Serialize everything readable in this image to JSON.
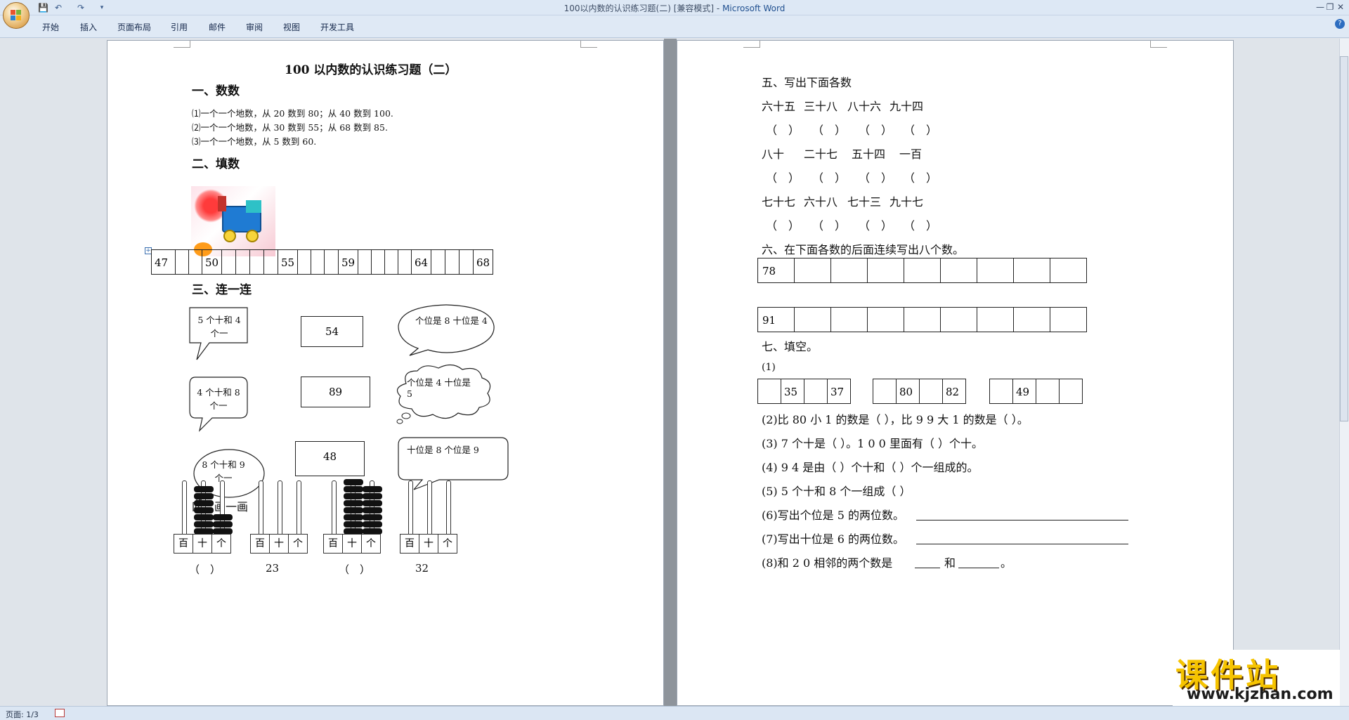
{
  "window": {
    "title": "100以内数的认识练习题(二) [兼容模式] - ",
    "app": "Microsoft Word"
  },
  "tabs": [
    "开始",
    "插入",
    "页面布局",
    "引用",
    "邮件",
    "审阅",
    "视图",
    "开发工具"
  ],
  "status": {
    "page": "页面: 1/3"
  },
  "watermark": {
    "big": "课件站",
    "url": "www.kjzhan.com"
  },
  "page1": {
    "title": "100 以内数的认识练习题（二）",
    "sec1": "一、数数",
    "sec1_lines": [
      "⑴一个一个地数，从 20 数到 80；从 40 数到 100.",
      "⑵一个一个地数，从 30 数到 55；从 68 数到 85.",
      "⑶一个一个地数，从 5 数到 60."
    ],
    "sec2": "二、填数",
    "train_cells": [
      "47",
      "",
      "",
      "50",
      "",
      "",
      "",
      "",
      "55",
      "",
      "",
      "",
      "59",
      "",
      "",
      "",
      "",
      "64",
      "",
      "",
      "",
      "68"
    ],
    "sec3": "三、连一连",
    "bubbles": [
      "5 个十和 4 个一",
      "4 个十和 8 个一",
      "8 个十和 9 个一"
    ],
    "numboxes": [
      "54",
      "89",
      "48"
    ],
    "clouds": [
      "个位是 8 十位是 4",
      "个位是 4 十位是 5",
      "十位是 8 个位是 9"
    ],
    "sec4": "四、画一画",
    "abacus_labels": [
      "百",
      "十",
      "个"
    ],
    "abacus_answers": [
      "（　）",
      "23",
      "（　）",
      "32"
    ]
  },
  "page2": {
    "sec5": "五、写出下面各数",
    "row1": [
      "六十五",
      "三十八",
      "八十六",
      "九十四"
    ],
    "row2": [
      "八十",
      "二十七",
      "五十四",
      "一百"
    ],
    "row3": [
      "七十七",
      "六十八",
      "七十三",
      "九十七"
    ],
    "paren": "（　）",
    "sec6": "六、在下面各数的后面连续写出八个数。",
    "start1": "78",
    "start2": "91",
    "sec7": "七、填空。",
    "q1": "(1)",
    "g1": [
      "",
      "35",
      "",
      "37"
    ],
    "g2": [
      "",
      "80",
      "",
      "82"
    ],
    "g3": [
      "",
      "49",
      "",
      ""
    ],
    "q2": "(2)比 80 小 1 的数是（  ），比 9 9 大 1 的数是（      ）。",
    "q3": "(3) 7 个十是（  ）。1 0 0 里面有（  ）个十。",
    "q4": "(4) 9 4 是由（  ）个十和（  ）个一组成的。",
    "q5": "(5) 5 个十和 8 个一组成（      ）",
    "q6": "(6)写出个位是 5 的两位数。",
    "q7": "(7)写出十位是 6 的两位数。",
    "q8a": "(8)和 2 0 相邻的两个数是",
    "q8b": "和",
    "q8c": "。"
  }
}
